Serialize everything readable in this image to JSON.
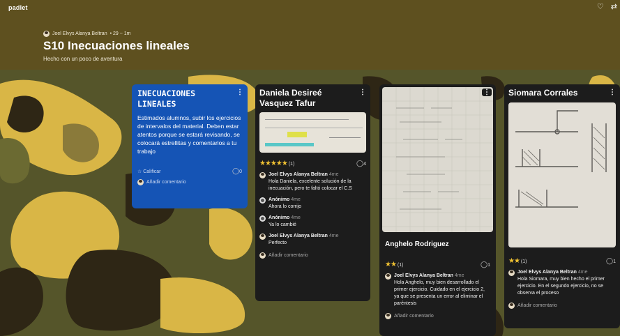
{
  "app": {
    "brand": "padlet"
  },
  "header": {
    "author": "Joel Elvys Alanya Beltran",
    "meta": "• 29 ~ 1m",
    "title": "S10 Inecuaciones lineales",
    "subtitle": "Hecho con un poco de aventura"
  },
  "cards": {
    "instructions": {
      "title": "INECUACIONES LINEALES",
      "body": "Estimados alumnos, subir los ejercicios de intervalos del material. Deben estar atentos porque se estará revisando, se colocará estrellitas y comentarios a tu trabajo",
      "rate_label": "Calificar",
      "comment_count": "0",
      "add_comment": "Añadir comentario"
    },
    "daniela": {
      "title": "Daniela Desireé Vasquez Tafur",
      "stars": "★★★★★",
      "rating_count": "(1)",
      "comment_count": "4",
      "comments": [
        {
          "name": "Joel Elvys Alanya Beltran",
          "time": "4me",
          "text": "Hola Daniela, excelente solución de la inecuación, pero te faltó colocar el C.S"
        },
        {
          "name": "Anónimo",
          "time": "4me",
          "text": "Ahora lo corrijo"
        },
        {
          "name": "Anónimo",
          "time": "4me",
          "text": "Ya lo cambié"
        },
        {
          "name": "Joel Elvys Alanya Beltran",
          "time": "4me",
          "text": "Perfecto"
        }
      ],
      "add_comment": "Añadir comentario"
    },
    "anghelo": {
      "title": "Anghelo Rodriguez",
      "stars": "★★",
      "rating_count": "(1)",
      "comment_count": "1",
      "comments": [
        {
          "name": "Joel Elvys Alanya Beltran",
          "time": "4me",
          "text": "Hola Anghelo, muy bien desarrollado el primer ejercicio. Cuidado en el ejercicio 2, ya que se presenta un error al eliminar el paréntesis"
        }
      ],
      "add_comment": "Añadir comentario"
    },
    "siomara": {
      "title": "Siomara Corrales",
      "stars": "★★",
      "rating_count": "(1)",
      "comment_count": "1",
      "comments": [
        {
          "name": "Joel Elvys Alanya Beltran",
          "time": "4me",
          "text": "Hola Siomara, muy bien hecho el primer ejercicio. En el segundo ejercicio, no se observa el proceso"
        }
      ],
      "add_comment": "Añadir comentario"
    }
  },
  "colors": {
    "header_bg": "#60501e",
    "instructions_bg": "#1554b5",
    "card_bg": "#1c1c1c",
    "star": "#f1c232",
    "camo": [
      "#55552a",
      "#d9b646",
      "#2e2615",
      "#6b6a32",
      "#8a7a3a"
    ]
  },
  "icons": [
    "heart-icon",
    "share-icon",
    "menu-dots-icon",
    "star-outline-icon",
    "comment-icon"
  ]
}
